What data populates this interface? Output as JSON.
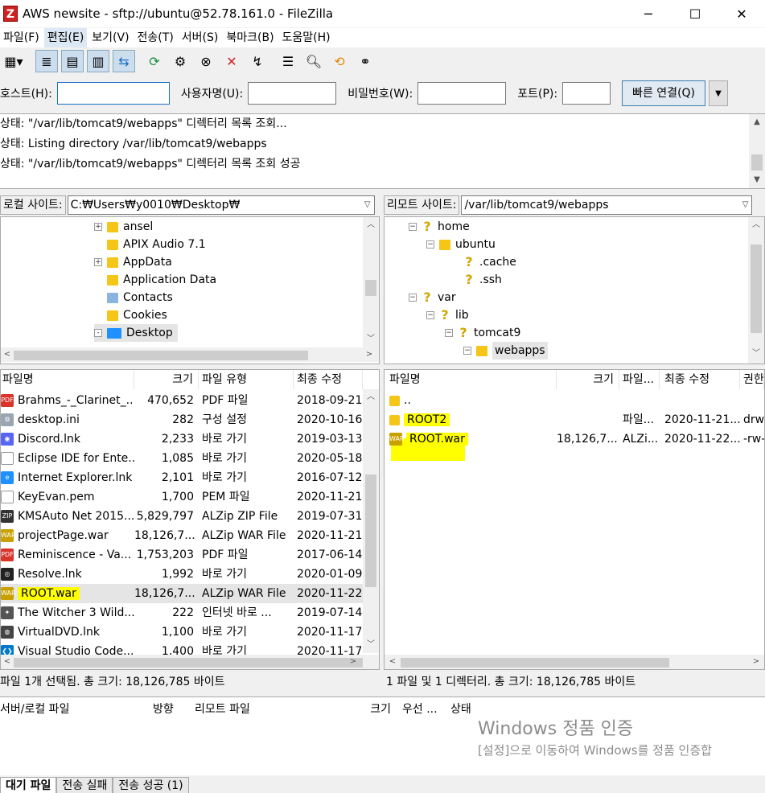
{
  "window": {
    "title": "AWS newsite - sftp://ubuntu@52.78.161.0 - FileZilla",
    "app_icon": "filezilla-icon",
    "controls": [
      "─",
      "☐",
      "✕"
    ]
  },
  "menu": [
    "파일(F)",
    "편집(E)",
    "보기(V)",
    "전송(T)",
    "서버(S)",
    "북마크(B)",
    "도움말(H)"
  ],
  "quickconnect": {
    "host_label": "호스트(H):",
    "user_label": "사용자명(U):",
    "pass_label": "비밀번호(W):",
    "port_label": "포트(P):",
    "host_value": "",
    "user_value": "",
    "pass_value": "",
    "port_value": "",
    "connect_label": "빠른 연결(Q)"
  },
  "log": [
    "상태:  \"/var/lib/tomcat9/webapps\" 디렉터리 목록 조회...",
    "상태:  Listing directory /var/lib/tomcat9/webapps",
    "상태:  \"/var/lib/tomcat9/webapps\" 디렉터리 목록 조회 성공"
  ],
  "local": {
    "site_label": "로컬 사이트:",
    "path": "C:₩Users₩y0010₩Desktop₩",
    "tree": [
      {
        "name": "ansel",
        "expander": "+"
      },
      {
        "name": "APIX Audio 7.1",
        "expander": ""
      },
      {
        "name": "AppData",
        "expander": "+"
      },
      {
        "name": "Application Data",
        "expander": ""
      },
      {
        "name": "Contacts",
        "expander": ""
      },
      {
        "name": "Cookies",
        "expander": ""
      },
      {
        "name": "Desktop",
        "expander": "-"
      }
    ],
    "columns": [
      "파일명",
      "크기",
      "파일 유형",
      "최종 수정"
    ],
    "files": [
      {
        "name": "Brahms_-_Clarinet_...",
        "size": "470,652",
        "type": "PDF 파일",
        "date": "2018-09-21",
        "icon": "pdf"
      },
      {
        "name": "desktop.ini",
        "size": "282",
        "type": "구성 설정",
        "date": "2020-10-16",
        "icon": "ini"
      },
      {
        "name": "Discord.lnk",
        "size": "2,233",
        "type": "바로 가기",
        "date": "2019-03-13",
        "icon": "discord"
      },
      {
        "name": "Eclipse IDE for Ente...",
        "size": "1,085",
        "type": "바로 가기",
        "date": "2020-05-18",
        "icon": "blank"
      },
      {
        "name": "Internet Explorer.lnk",
        "size": "2,101",
        "type": "바로 가기",
        "date": "2016-07-12",
        "icon": "ie"
      },
      {
        "name": "KeyEvan.pem",
        "size": "1,700",
        "type": "PEM 파일",
        "date": "2020-11-21",
        "icon": "blank"
      },
      {
        "name": "KMSAuto Net 2015...",
        "size": "5,829,797",
        "type": "ALZip ZIP File",
        "date": "2019-07-31",
        "icon": "zip"
      },
      {
        "name": "projectPage.war",
        "size": "18,126,7...",
        "type": "ALZip WAR File",
        "date": "2020-11-21",
        "icon": "war"
      },
      {
        "name": "Reminiscence - Va...",
        "size": "1,753,203",
        "type": "PDF 파일",
        "date": "2017-06-14",
        "icon": "pdf"
      },
      {
        "name": "Resolve.lnk",
        "size": "1,992",
        "type": "바로 가기",
        "date": "2020-01-09",
        "icon": "resolve"
      },
      {
        "name": "ROOT.war",
        "size": "18,126,7...",
        "type": "ALZip WAR File",
        "date": "2020-11-22",
        "icon": "war"
      },
      {
        "name": "The Witcher 3 Wild...",
        "size": "222",
        "type": "인터넷 바로 ...",
        "date": "2019-07-14",
        "icon": "witcher"
      },
      {
        "name": "VirtualDVD.lnk",
        "size": "1,100",
        "type": "바로 가기",
        "date": "2020-11-17",
        "icon": "dvd"
      },
      {
        "name": "Visual Studio Code...",
        "size": "1,400",
        "type": "바로 가기",
        "date": "2020-11-17",
        "icon": "vscode"
      }
    ],
    "status": "파일 1개 선택됨. 총 크기: 18,126,785 바이트"
  },
  "remote": {
    "site_label": "리모트 사이트:",
    "path": "/var/lib/tomcat9/webapps",
    "tree": [
      {
        "name": "home",
        "kind": "q"
      },
      {
        "name": "ubuntu",
        "kind": "f"
      },
      {
        "name": ".cache",
        "kind": "q"
      },
      {
        "name": ".ssh",
        "kind": "q"
      },
      {
        "name": "var",
        "kind": "q"
      },
      {
        "name": "lib",
        "kind": "q"
      },
      {
        "name": "tomcat9",
        "kind": "q"
      },
      {
        "name": "webapps",
        "kind": "f"
      }
    ],
    "columns": [
      "파일명",
      "크기",
      "파일...",
      "최종 수정",
      "권한"
    ],
    "files": [
      {
        "name": "..",
        "size": "",
        "type": "",
        "date": "",
        "perm": "",
        "icon": "folder"
      },
      {
        "name": "ROOT2",
        "size": "",
        "type": "파일...",
        "date": "2020-11-21...",
        "perm": "drw",
        "icon": "folder"
      },
      {
        "name": "ROOT.war",
        "size": "18,126,7...",
        "type": "ALZi...",
        "date": "2020-11-22...",
        "perm": "-rw-",
        "icon": "war"
      }
    ],
    "status": "1 파일 및 1 디렉터리. 총 크기: 18,126,785 바이트"
  },
  "queue": {
    "columns": [
      "서버/로컬 파일",
      "방향",
      "리모트 파일",
      "크기",
      "우선 ...",
      "상태"
    ],
    "tabs": [
      "대기 파일",
      "전송 실패",
      "전송 성공 (1)"
    ]
  },
  "watermark": {
    "line1": "Windows 정품 인증",
    "line2": "[설정]으로 이동하여 Windows를 정품 인증합"
  },
  "colors": {
    "highlight": "#ffff00",
    "folder": "#f5c518",
    "pdf": "#d9332b"
  }
}
